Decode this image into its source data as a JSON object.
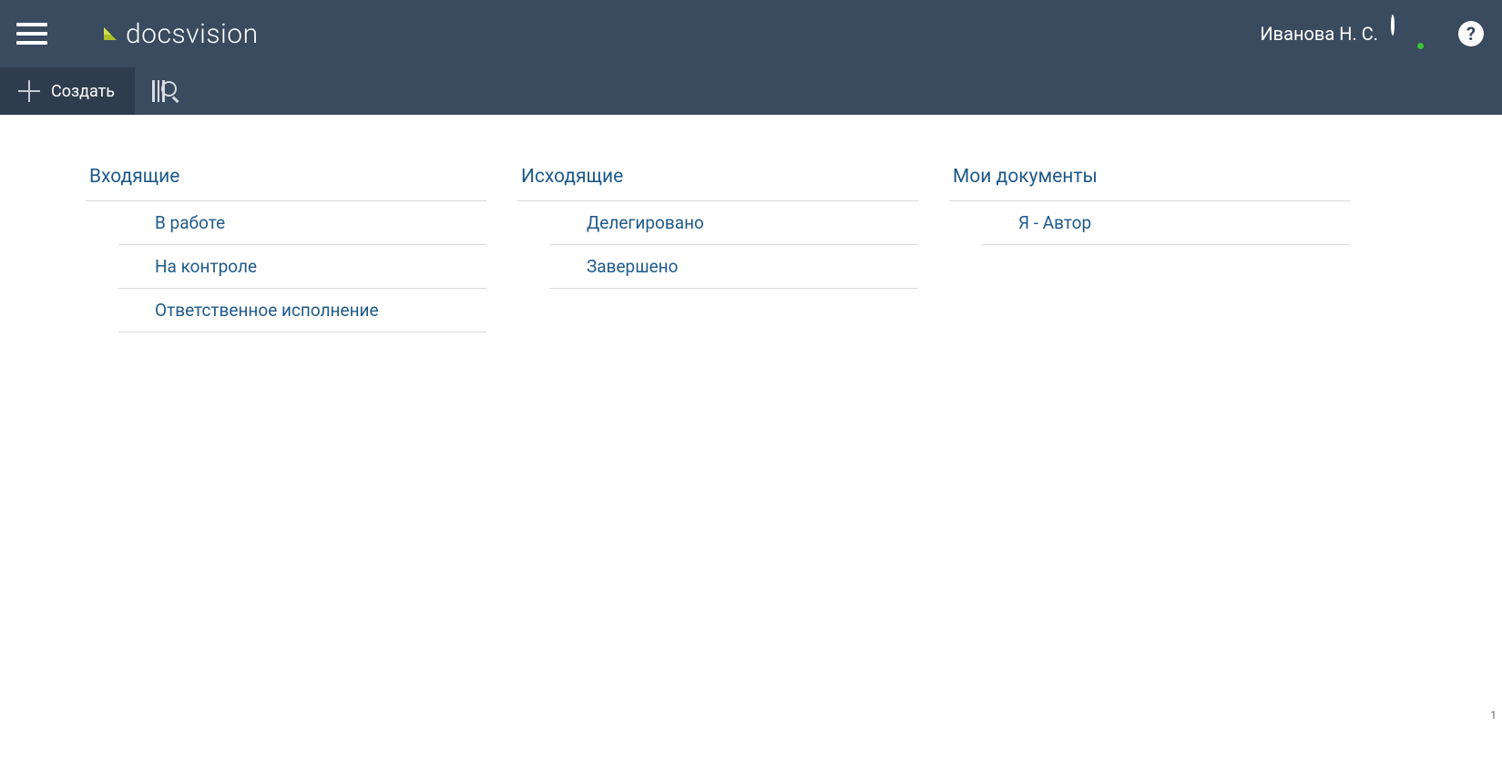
{
  "brand": {
    "name": "docsvision"
  },
  "user": {
    "display_name": "Иванова Н. С."
  },
  "toolbar": {
    "create_label": "Создать"
  },
  "columns": [
    {
      "title": "Входящие",
      "items": [
        "В работе",
        "На контроле",
        "Ответственное исполнение"
      ]
    },
    {
      "title": "Исходящие",
      "items": [
        "Делегировано",
        "Завершено"
      ]
    },
    {
      "title": "Мои документы",
      "items": [
        "Я - Автор"
      ]
    }
  ],
  "footer_mark": "1"
}
